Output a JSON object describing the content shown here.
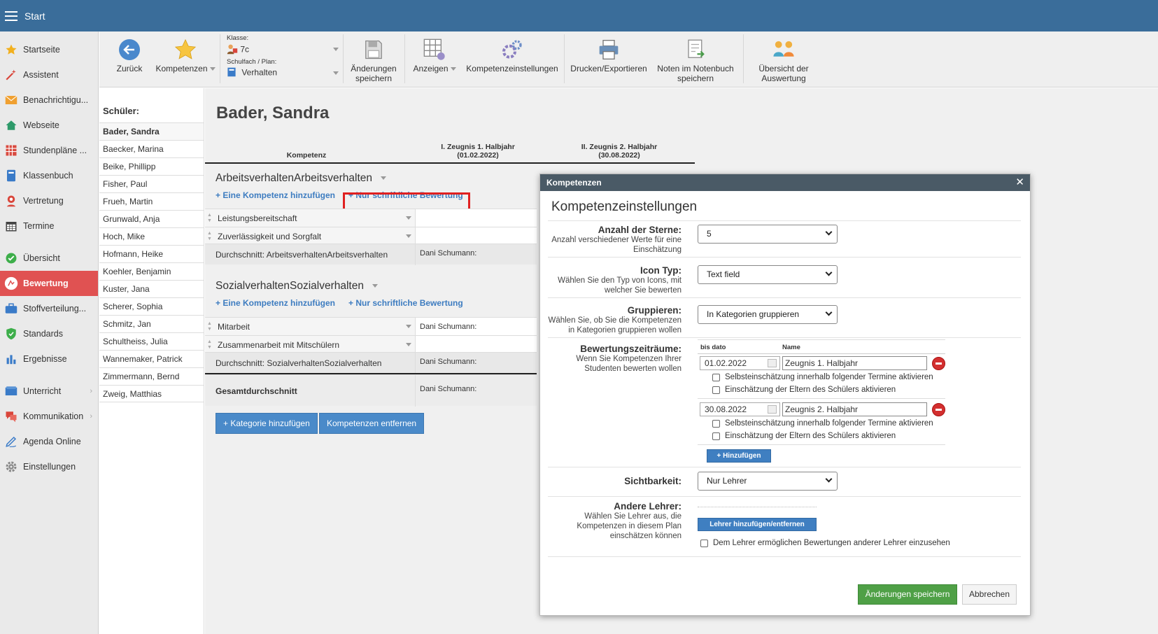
{
  "topbar": {
    "title": "Start"
  },
  "sidebar": {
    "items": [
      {
        "label": "Startseite",
        "icon": "star-icon"
      },
      {
        "label": "Assistent",
        "icon": "wand-icon"
      },
      {
        "label": "Benachrichtigu...",
        "icon": "envelope-icon"
      },
      {
        "label": "Webseite",
        "icon": "house-icon"
      },
      {
        "label": "Stundenpläne ...",
        "icon": "grid-icon"
      },
      {
        "label": "Klassenbuch",
        "icon": "book-icon"
      },
      {
        "label": "Vertretung",
        "icon": "person-icon"
      },
      {
        "label": "Termine",
        "icon": "calendar-icon"
      },
      {
        "label": "Übersicht",
        "icon": "check-circle-icon"
      },
      {
        "label": "Bewertung",
        "icon": "rating-icon"
      },
      {
        "label": "Stoffverteilung...",
        "icon": "briefcase-icon"
      },
      {
        "label": "Standards",
        "icon": "shield-icon"
      },
      {
        "label": "Ergebnisse",
        "icon": "bar-chart-icon"
      },
      {
        "label": "Unterricht",
        "icon": "book-open-icon"
      },
      {
        "label": "Kommunikation",
        "icon": "chat-icon"
      },
      {
        "label": "Agenda Online",
        "icon": "pen-icon"
      },
      {
        "label": "Einstellungen",
        "icon": "gear-icon"
      }
    ],
    "colors": {
      "active_bg": "#e05252"
    }
  },
  "toolbar": {
    "back": "Zurück",
    "kompetenzen": "Kompetenzen",
    "klasse_label": "Klasse:",
    "klasse_value": "7c",
    "schulfach_label": "Schulfach / Plan:",
    "schulfach_value": "Verhalten",
    "save_line1": "Änderungen",
    "save_line2": "speichern",
    "anzeigen": "Anzeigen",
    "settings": "Kompetenzeinstellungen",
    "print": "Drucken/Exportieren",
    "notebook_line1": "Noten im Notenbuch",
    "notebook_line2": "speichern",
    "overview_line1": "Übersicht der",
    "overview_line2": "Auswertung"
  },
  "students": {
    "header": "Schüler:",
    "list": [
      "Bader, Sandra",
      "Baecker, Marina",
      "Beike, Phillipp",
      "Fisher, Paul",
      "Frueh, Martin",
      "Grunwald, Anja",
      "Hoch, Mike",
      "Hofmann, Heike",
      "Koehler, Benjamin",
      "Kuster, Jana",
      "Scherer, Sophia",
      "Schmitz, Jan",
      "Schultheiss, Julia",
      "Wannemaker, Patrick",
      "Zimmermann, Bernd",
      "Zweig, Matthias"
    ]
  },
  "main": {
    "student_name": "Bader, Sandra",
    "col_kompetenz": "Kompetenz",
    "col1_line1": "I. Zeugnis 1. Halbjahr",
    "col1_line2": "(01.02.2022)",
    "col2_line1": "II. Zeugnis 2. Halbjahr",
    "col2_line2": "(30.08.2022)",
    "categories": [
      {
        "title": "ArbeitsverhaltenArbeitsverhalten",
        "add_link": "+ Eine Kompetenz hinzufügen",
        "written_link": "+ Nur schriftliche Bewertung",
        "rows": [
          {
            "label": "Leistungsbereitschaft",
            "teacher": ""
          },
          {
            "label": "Zuverlässigkeit und Sorgfalt",
            "teacher": ""
          }
        ],
        "avg_label": "Durchschnitt: ArbeitsverhaltenArbeitsverhalten",
        "avg_teacher": "Dani Schumann:"
      },
      {
        "title": "SozialverhaltenSozialverhalten",
        "add_link": "+ Eine Kompetenz hinzufügen",
        "written_link": "+ Nur schriftliche Bewertung",
        "rows": [
          {
            "label": "Mitarbeit",
            "teacher": "Dani Schumann:"
          },
          {
            "label": "Zusammenarbeit mit Mitschülern",
            "teacher": ""
          }
        ],
        "avg_label": "Durchschnitt: SozialverhaltenSozialverhalten",
        "avg_teacher": "Dani Schumann:"
      }
    ],
    "total_label": "Gesamtdurchschnitt",
    "total_teacher": "Dani Schumann:",
    "add_category": "+ Kategorie hinzufügen",
    "remove_competences": "Kompetenzen entfernen"
  },
  "modal": {
    "header": "Kompetenzen",
    "title": "Kompetenzeinstellungen",
    "stars_label": "Anzahl der Sterne:",
    "stars_desc": [
      "Anzahl verschiedener Werte für eine",
      "Einschätzung"
    ],
    "stars_value": "5",
    "icon_label": "Icon Typ:",
    "icon_desc": [
      "Wählen Sie den Typ von Icons, mit",
      "welcher Sie bewerten"
    ],
    "icon_value": "Text field",
    "group_label": "Gruppieren:",
    "group_desc": [
      "Wählen Sie, ob Sie die Kompetenzen",
      "in Kategorien gruppieren wollen"
    ],
    "group_value": "In Kategorien gruppieren",
    "periods_label": "Bewertungszeiträume:",
    "periods_desc": [
      "Wenn Sie Kompetenzen Ihrer",
      "Studenten bewerten wollen"
    ],
    "col_date": "bis dato",
    "col_name": "Name",
    "periods": [
      {
        "date": "01.02.2022",
        "name": "Zeugnis 1. Halbjahr"
      },
      {
        "date": "30.08.2022",
        "name": "Zeugnis 2. Halbjahr"
      }
    ],
    "cb_self": "Selbsteinschätzung innerhalb folgender Termine aktivieren",
    "cb_parents": "Einschätzung der Eltern des Schülers aktivieren",
    "add_period": "+ Hinzufügen",
    "visibility_label": "Sichtbarkeit:",
    "visibility_value": "Nur Lehrer",
    "teachers_label": "Andere Lehrer:",
    "teachers_desc": [
      "Wählen Sie Lehrer aus, die",
      "Kompetenzen in diesem Plan",
      "einschätzen können"
    ],
    "teachers_button": "Lehrer hinzufügen/entfernen",
    "teachers_cb": "Dem Lehrer ermöglichen Bewertungen anderer Lehrer einzusehen",
    "save": "Änderungen speichern",
    "cancel": "Abbrechen"
  }
}
